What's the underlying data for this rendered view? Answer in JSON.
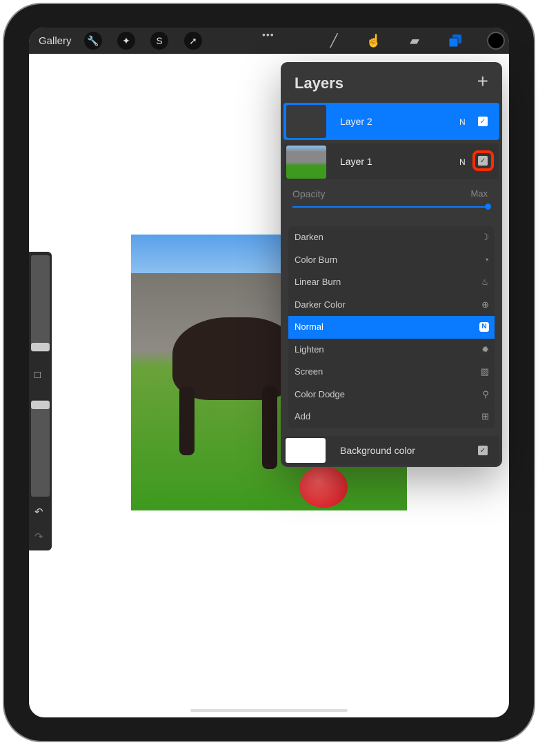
{
  "toolbar": {
    "gallery": "Gallery",
    "tools": [
      "wrench-icon",
      "magic-wand-icon",
      "selection-icon",
      "move-arrow-icon"
    ],
    "right_tools": [
      "brush-icon",
      "smudge-icon",
      "eraser-icon",
      "layers-icon"
    ],
    "more": "•••",
    "current_color": "#000000"
  },
  "layers_panel": {
    "title": "Layers",
    "add": "+",
    "layers": [
      {
        "name": "Layer 2",
        "mode": "N",
        "visible": true,
        "selected": true
      },
      {
        "name": "Layer 1",
        "mode": "N",
        "visible": true,
        "selected": false,
        "highlighted_checkbox": true
      }
    ],
    "opacity": {
      "label": "Opacity",
      "max_label": "Max",
      "value": 1.0
    },
    "blend_modes": [
      {
        "label": "Darken",
        "icon": "moon-icon",
        "glyph": "☽"
      },
      {
        "label": "Color Burn",
        "icon": "burn-icon",
        "glyph": "◔"
      },
      {
        "label": "Linear Burn",
        "icon": "flame-icon",
        "glyph": "♨"
      },
      {
        "label": "Darker Color",
        "icon": "plus-circle-icon",
        "glyph": "⊕"
      },
      {
        "label": "Normal",
        "icon": "n-icon",
        "glyph": "N",
        "selected": true
      },
      {
        "label": "Lighten",
        "icon": "sun-icon",
        "glyph": "✹"
      },
      {
        "label": "Screen",
        "icon": "stripes-icon",
        "glyph": "▨"
      },
      {
        "label": "Color Dodge",
        "icon": "magnifier-icon",
        "glyph": "⚲"
      },
      {
        "label": "Add",
        "icon": "plus-square-icon",
        "glyph": "⊞"
      }
    ],
    "background": {
      "label": "Background color",
      "visible": true
    }
  },
  "sidebar": {
    "modify": "□",
    "undo": "↶",
    "redo": "↷"
  },
  "colors": {
    "accent": "#0a7aff",
    "highlight": "#ff2a00",
    "panel": "#383838"
  }
}
